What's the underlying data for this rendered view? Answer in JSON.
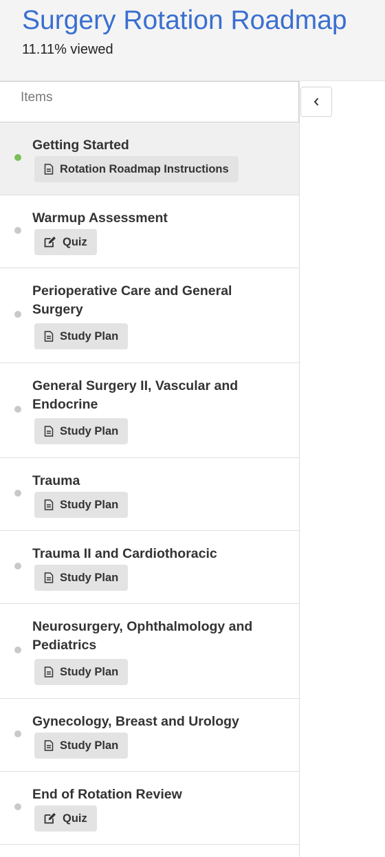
{
  "header": {
    "title": "Surgery Rotation Roadmap",
    "progress": "11.11% viewed"
  },
  "sidebar": {
    "header": "Items",
    "items": [
      {
        "name": "Getting Started",
        "badge": "Rotation Roadmap Instructions",
        "icon": "document-icon",
        "status": "viewed"
      },
      {
        "name": "Warmup Assessment",
        "badge": "Quiz",
        "icon": "edit-icon",
        "status": "unviewed"
      },
      {
        "name": "Perioperative Care and General Surgery",
        "badge": "Study Plan",
        "icon": "document-icon",
        "status": "unviewed"
      },
      {
        "name": "General Surgery II, Vascular and Endocrine",
        "badge": "Study Plan",
        "icon": "document-icon",
        "status": "unviewed"
      },
      {
        "name": "Trauma",
        "badge": "Study Plan",
        "icon": "document-icon",
        "status": "unviewed"
      },
      {
        "name": "Trauma II and Cardiothoracic",
        "badge": "Study Plan",
        "icon": "document-icon",
        "status": "unviewed"
      },
      {
        "name": "Neurosurgery, Ophthalmology and Pediatrics",
        "badge": "Study Plan",
        "icon": "document-icon",
        "status": "unviewed"
      },
      {
        "name": "Gynecology, Breast and Urology",
        "badge": "Study Plan",
        "icon": "document-icon",
        "status": "unviewed"
      },
      {
        "name": "End of Rotation Review",
        "badge": "Quiz",
        "icon": "edit-icon",
        "status": "unviewed"
      }
    ]
  },
  "colors": {
    "title": "#3a6fd0",
    "viewed_dot": "#7cbf5a",
    "unviewed_dot": "#c9c9c9"
  }
}
